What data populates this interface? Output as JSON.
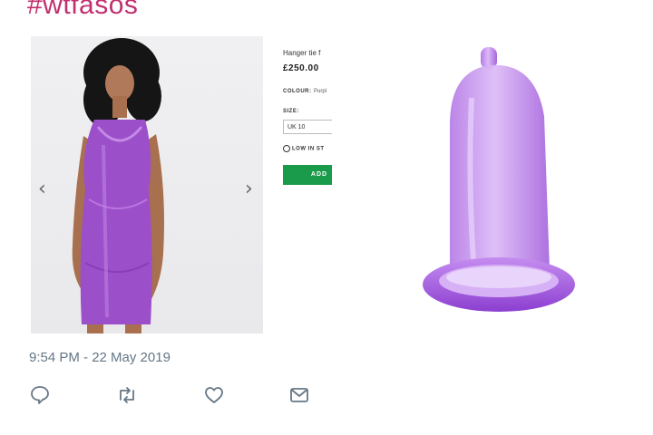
{
  "tweet": {
    "hashtag": "#wtfasos",
    "timestamp": "9:54 PM - 22 May 2019"
  },
  "product": {
    "name": "Hanger tie f",
    "price": "£250.00",
    "colour_label": "COLOUR:",
    "colour_value": "Purpl",
    "size_label": "SIZE:",
    "size_value": "UK 10",
    "stock_label": "LOW IN ST",
    "add_label": "ADD",
    "nav_prev": "‹",
    "nav_next": "›"
  },
  "icons": {
    "reply": "reply-icon",
    "retweet": "retweet-icon",
    "like": "heart-icon",
    "message": "envelope-icon"
  },
  "colors": {
    "hashtag": "#c2306f",
    "add_button": "#1a9b4b",
    "meta_text": "#657786",
    "purple": "#9b4fc9"
  }
}
